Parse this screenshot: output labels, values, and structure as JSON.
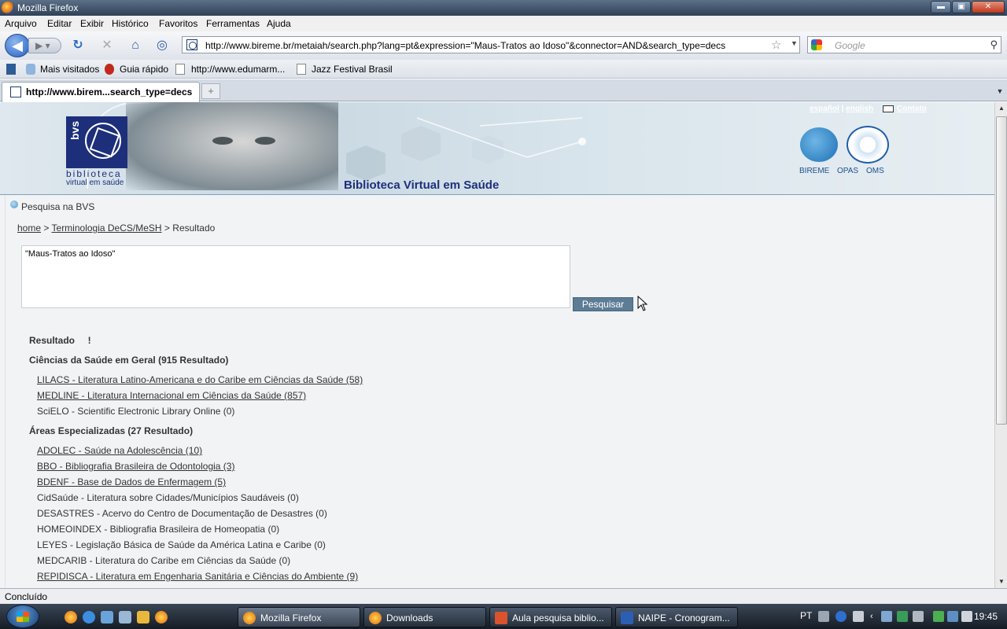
{
  "window": {
    "title": "Mozilla Firefox",
    "controls": {
      "minimize": "▬",
      "maximize": "▣",
      "close": "✕"
    }
  },
  "menu": [
    "Arquivo",
    "Editar",
    "Exibir",
    "Histórico",
    "Favoritos",
    "Ferramentas",
    "Ajuda"
  ],
  "nav": {
    "url": "http://www.bireme.br/metaiah/search.php?lang=pt&expression=\"Maus-Tratos ao Idoso\"&connector=AND&search_type=decs",
    "search_placeholder": "Google"
  },
  "bookmarks": [
    "Mais visitados",
    "Guia rápido",
    "http://www.edumarm...",
    "Jazz Festival Brasil"
  ],
  "tabs": [
    {
      "label": "http://www.birem...search_type=decs"
    }
  ],
  "page": {
    "header": {
      "languages": [
        "español",
        "english"
      ],
      "contact": "Contato",
      "logo_line1": "biblioteca",
      "logo_line2": "virtual em saúde",
      "logo_mark": "bvs",
      "title": "Biblioteca Virtual em Saúde",
      "orgs": [
        "BIREME",
        "OPAS",
        "OMS"
      ]
    },
    "section_title": "Pesquisa na BVS",
    "breadcrumb": {
      "home": "home",
      "sep": ">",
      "decs": "Terminologia DeCS/MeSH",
      "current": "Resultado"
    },
    "query_value": "\"Maus-Tratos ao Idoso\"",
    "search_button": "Pesquisar",
    "result_heading": "Resultado     !",
    "groups": [
      {
        "title": "Ciências da Saúde em Geral (915 Resultado)",
        "items": [
          {
            "text": "LILACS - Literatura Latino-Americana e do Caribe em Ciências da Saúde (58)",
            "link": true
          },
          {
            "text": "MEDLINE - Literatura Internacional em Ciências da Saúde (857)",
            "link": true
          },
          {
            "text": "SciELO - Scientific Electronic Library Online (0)",
            "link": false
          }
        ]
      },
      {
        "title": "Áreas Especializadas (27 Resultado)",
        "items": [
          {
            "text": "ADOLEC - Saúde na Adolescência (10)",
            "link": true
          },
          {
            "text": "BBO - Bibliografia Brasileira de Odontologia (3)",
            "link": true
          },
          {
            "text": "BDENF - Base de Dados de Enfermagem (5)",
            "link": true
          },
          {
            "text": "CidSaúde - Literatura sobre Cidades/Municípios Saudáveis (0)",
            "link": false
          },
          {
            "text": "DESASTRES - Acervo do Centro de Documentação de Desastres (0)",
            "link": false
          },
          {
            "text": "HOMEOINDEX - Bibliografia Brasileira de Homeopatia (0)",
            "link": false
          },
          {
            "text": "LEYES - Legislação Básica de Saúde da América Latina e Caribe (0)",
            "link": false
          },
          {
            "text": "MEDCARIB - Literatura do Caribe em Ciências da Saúde (0)",
            "link": false
          },
          {
            "text": "REPIDISCA - Literatura em Engenharia Sanitária e Ciências do Ambiente (9)",
            "link": true
          }
        ]
      }
    ]
  },
  "status": "Concluído",
  "taskbar": {
    "tasks": [
      {
        "label": "Mozilla Firefox",
        "active": true
      },
      {
        "label": "Downloads",
        "active": false
      },
      {
        "label": "Aula pesquisa biblio...",
        "active": false
      },
      {
        "label": "NAIPE - Cronogram...",
        "active": false
      }
    ],
    "lang": "PT",
    "time": "19:45"
  },
  "colors": {
    "accent": "#1d2f7a",
    "button": "#5d7d96",
    "link_text": "#333333"
  }
}
